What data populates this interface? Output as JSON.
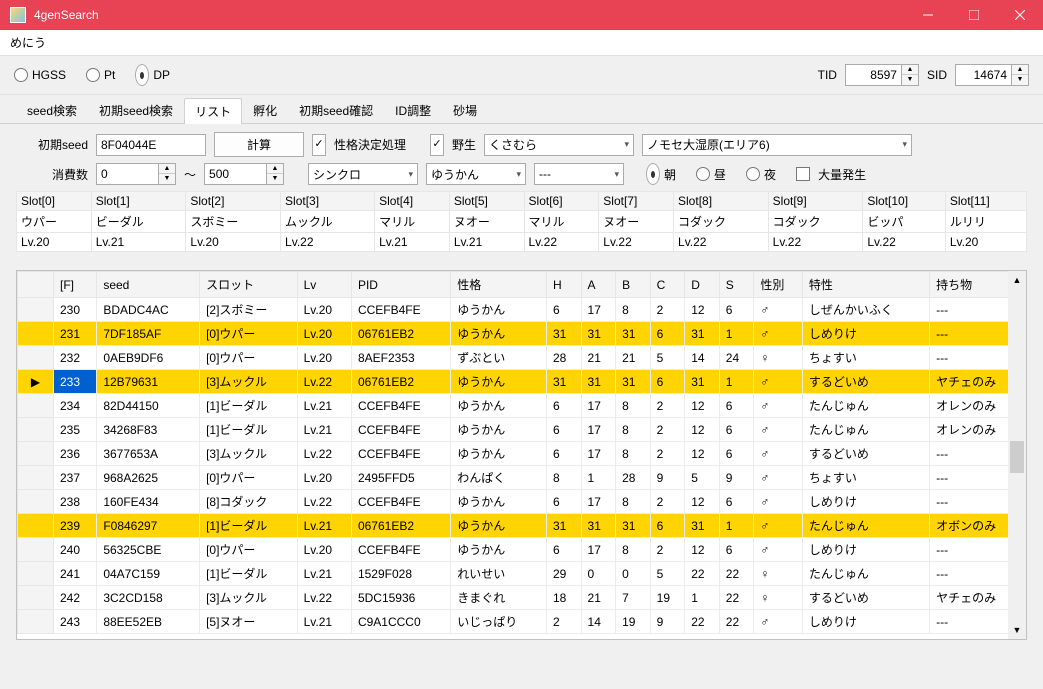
{
  "window": {
    "title": "4genSearch"
  },
  "menu": {
    "label": "めにう"
  },
  "gameRadios": {
    "hgss": "HGSS",
    "pt": "Pt",
    "dp": "DP",
    "selected": "dp"
  },
  "idFields": {
    "tidLabel": "TID",
    "tidValue": "8597",
    "sidLabel": "SID",
    "sidValue": "14674"
  },
  "tabs": [
    "seed検索",
    "初期seed検索",
    "リスト",
    "孵化",
    "初期seed確認",
    "ID調整",
    "砂場"
  ],
  "activeTab": "リスト",
  "listPanel": {
    "initSeedLabel": "初期seed",
    "initSeedValue": "8F04044E",
    "calcBtn": "計算",
    "natureDecideLabel": "性格決定処理",
    "wildLabel": "野生",
    "encounter": "くさむら",
    "location": "ノモセ大湿原(エリア6)",
    "consLabel": "消費数",
    "consFrom": "0",
    "consTo": "500",
    "tilde": "～",
    "leadMethod": "シンクロ",
    "leadNature": "ゆうかん",
    "leadExtra": "---",
    "timeRadios": {
      "morning": "朝",
      "day": "昼",
      "night": "夜",
      "selected": "morning"
    },
    "massOutbreakLabel": "大量発生"
  },
  "slotTable": {
    "headers": [
      "Slot[0]",
      "Slot[1]",
      "Slot[2]",
      "Slot[3]",
      "Slot[4]",
      "Slot[5]",
      "Slot[6]",
      "Slot[7]",
      "Slot[8]",
      "Slot[9]",
      "Slot[10]",
      "Slot[11]"
    ],
    "row1": [
      "ウパー",
      "ビーダル",
      "スボミー",
      "ムックル",
      "マリル",
      "ヌオー",
      "マリル",
      "ヌオー",
      "コダック",
      "コダック",
      "ビッパ",
      "ルリリ"
    ],
    "row2": [
      "Lv.20",
      "Lv.21",
      "Lv.20",
      "Lv.22",
      "Lv.21",
      "Lv.21",
      "Lv.22",
      "Lv.22",
      "Lv.22",
      "Lv.22",
      "Lv.22",
      "Lv.20"
    ]
  },
  "results": {
    "headers": [
      "[F]",
      "seed",
      "スロット",
      "Lv",
      "PID",
      "性格",
      "H",
      "A",
      "B",
      "C",
      "D",
      "S",
      "性別",
      "特性",
      "持ち物"
    ],
    "currentRow": 3,
    "rows": [
      {
        "hi": false,
        "c": [
          "230",
          "BDADC4AC",
          "[2]スボミー",
          "Lv.20",
          "CCEFB4FE",
          "ゆうかん",
          "6",
          "17",
          "8",
          "2",
          "12",
          "6",
          "♂",
          "しぜんかいふく",
          "---"
        ]
      },
      {
        "hi": true,
        "c": [
          "231",
          "7DF185AF",
          "[0]ウパー",
          "Lv.20",
          "06761EB2",
          "ゆうかん",
          "31",
          "31",
          "31",
          "6",
          "31",
          "1",
          "♂",
          "しめりけ",
          "---"
        ]
      },
      {
        "hi": false,
        "c": [
          "232",
          "0AEB9DF6",
          "[0]ウパー",
          "Lv.20",
          "8AEF2353",
          "ずぶとい",
          "28",
          "21",
          "21",
          "5",
          "14",
          "24",
          "♀",
          "ちょすい",
          "---"
        ]
      },
      {
        "hi": true,
        "c": [
          "233",
          "12B79631",
          "[3]ムックル",
          "Lv.22",
          "06761EB2",
          "ゆうかん",
          "31",
          "31",
          "31",
          "6",
          "31",
          "1",
          "♂",
          "するどいめ",
          "ヤチェのみ"
        ]
      },
      {
        "hi": false,
        "c": [
          "234",
          "82D44150",
          "[1]ビーダル",
          "Lv.21",
          "CCEFB4FE",
          "ゆうかん",
          "6",
          "17",
          "8",
          "2",
          "12",
          "6",
          "♂",
          "たんじゅん",
          "オレンのみ"
        ]
      },
      {
        "hi": false,
        "c": [
          "235",
          "34268F83",
          "[1]ビーダル",
          "Lv.21",
          "CCEFB4FE",
          "ゆうかん",
          "6",
          "17",
          "8",
          "2",
          "12",
          "6",
          "♂",
          "たんじゅん",
          "オレンのみ"
        ]
      },
      {
        "hi": false,
        "c": [
          "236",
          "3677653A",
          "[3]ムックル",
          "Lv.22",
          "CCEFB4FE",
          "ゆうかん",
          "6",
          "17",
          "8",
          "2",
          "12",
          "6",
          "♂",
          "するどいめ",
          "---"
        ]
      },
      {
        "hi": false,
        "c": [
          "237",
          "968A2625",
          "[0]ウパー",
          "Lv.20",
          "2495FFD5",
          "わんぱく",
          "8",
          "1",
          "28",
          "9",
          "5",
          "9",
          "♂",
          "ちょすい",
          "---"
        ]
      },
      {
        "hi": false,
        "c": [
          "238",
          "160FE434",
          "[8]コダック",
          "Lv.22",
          "CCEFB4FE",
          "ゆうかん",
          "6",
          "17",
          "8",
          "2",
          "12",
          "6",
          "♂",
          "しめりけ",
          "---"
        ]
      },
      {
        "hi": true,
        "c": [
          "239",
          "F0846297",
          "[1]ビーダル",
          "Lv.21",
          "06761EB2",
          "ゆうかん",
          "31",
          "31",
          "31",
          "6",
          "31",
          "1",
          "♂",
          "たんじゅん",
          "オボンのみ"
        ]
      },
      {
        "hi": false,
        "c": [
          "240",
          "56325CBE",
          "[0]ウパー",
          "Lv.20",
          "CCEFB4FE",
          "ゆうかん",
          "6",
          "17",
          "8",
          "2",
          "12",
          "6",
          "♂",
          "しめりけ",
          "---"
        ]
      },
      {
        "hi": false,
        "c": [
          "241",
          "04A7C159",
          "[1]ビーダル",
          "Lv.21",
          "1529F028",
          "れいせい",
          "29",
          "0",
          "0",
          "5",
          "22",
          "22",
          "♀",
          "たんじゅん",
          "---"
        ]
      },
      {
        "hi": false,
        "c": [
          "242",
          "3C2CD158",
          "[3]ムックル",
          "Lv.22",
          "5DC15936",
          "きまぐれ",
          "18",
          "21",
          "7",
          "19",
          "1",
          "22",
          "♀",
          "するどいめ",
          "ヤチェのみ"
        ]
      },
      {
        "hi": false,
        "c": [
          "243",
          "88EE52EB",
          "[5]ヌオー",
          "Lv.21",
          "C9A1CCC0",
          "いじっぱり",
          "2",
          "14",
          "19",
          "9",
          "22",
          "22",
          "♂",
          "しめりけ",
          "---"
        ]
      }
    ]
  }
}
